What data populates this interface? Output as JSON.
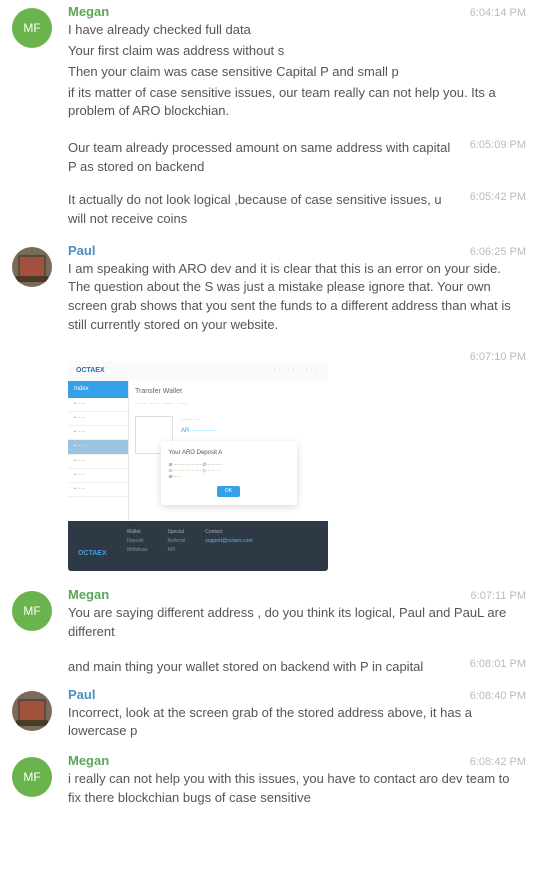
{
  "users": {
    "megan": {
      "name": "Megan",
      "initials": "MF"
    },
    "paul": {
      "name": "Paul"
    }
  },
  "messages": {
    "m1": {
      "time": "6:04:14 PM",
      "lines": [
        "I have already checked full data",
        "Your first claim was address without s",
        "Then your claim was case sensitive Capital P and small p",
        "if its matter of case sensitive issues, our team really can not help you. Its a problem of ARO blockchian."
      ]
    },
    "m1b": {
      "time": "6:05:09 PM",
      "text": "Our team already processed amount on same address with capital P as stored on backend"
    },
    "m1c": {
      "time": "6:05:42 PM",
      "text": "It actually do not look logical ,because of case sensitive issues, u will not receive coins"
    },
    "m2": {
      "time": "6:06:25 PM",
      "text": "I am speaking with ARO dev and it is clear that this is an error on your side.  The question about the S was just a mistake please ignore that.  Your own screen grab shows that you sent the funds to a different address than what is still currently stored on your website."
    },
    "m2b": {
      "time": "6:07:10 PM"
    },
    "m3": {
      "time": "6:07:11 PM",
      "text": "You are saying different address , do you think its logical, Paul and PauL are different"
    },
    "m3b": {
      "time": "6:08:01 PM",
      "text": "and main thing your wallet stored on backend with P in capital"
    },
    "m4": {
      "time": "6:08:40 PM",
      "text": "Incorrect, look at the screen grab of the stored address above, it has a lowercase p"
    },
    "m5": {
      "time": "6:08:42 PM",
      "text": "i really can not help you with this issues, you have to contact aro dev team to fix there blockchian bugs of case sensitive"
    }
  },
  "attachment": {
    "logo": "OCTAEX",
    "side_header": "Index",
    "title": "Transfer Wallet",
    "modal_title": "Your ARO Deposit A",
    "modal_btn": "OK",
    "footer_cols": {
      "c1h": "Wallet",
      "c1a": "Deposit",
      "c1b": "Withdraw",
      "c2h": "Special",
      "c2a": "Referral",
      "c2b": "API",
      "c3h": "Contact",
      "c3a": "support@octaex.com"
    }
  }
}
